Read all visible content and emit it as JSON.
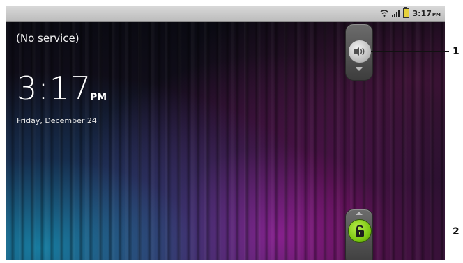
{
  "status_bar": {
    "time": "3:17",
    "ampm": "PM",
    "icons": [
      "wifi-icon",
      "signal-icon",
      "battery-icon"
    ],
    "battery_color": "#e6d23c"
  },
  "lock_screen": {
    "carrier": "(No service)",
    "clock_time": "3:17",
    "clock_ampm": "PM",
    "date": "Friday, December 24"
  },
  "controls": {
    "sound_toggle_icon": "speaker-icon",
    "unlock_icon": "unlock-icon",
    "unlock_color": "#79c410"
  },
  "callouts": [
    {
      "label": "1"
    },
    {
      "label": "2"
    }
  ]
}
